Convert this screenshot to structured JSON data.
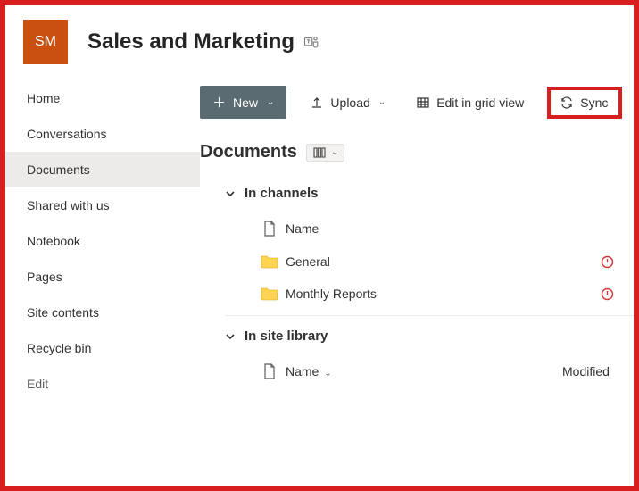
{
  "site": {
    "tile_initials": "SM",
    "title": "Sales and Marketing"
  },
  "sidebar": {
    "items": [
      {
        "label": "Home"
      },
      {
        "label": "Conversations"
      },
      {
        "label": "Documents"
      },
      {
        "label": "Shared with us"
      },
      {
        "label": "Notebook"
      },
      {
        "label": "Pages"
      },
      {
        "label": "Site contents"
      },
      {
        "label": "Recycle bin"
      }
    ],
    "edit_label": "Edit"
  },
  "toolbar": {
    "new_label": "New",
    "upload_label": "Upload",
    "grid_label": "Edit in grid view",
    "sync_label": "Sync"
  },
  "page": {
    "title": "Documents"
  },
  "sections": {
    "channels": {
      "title": "In channels",
      "columns": {
        "name": "Name"
      },
      "rows": [
        {
          "name": "General"
        },
        {
          "name": "Monthly Reports"
        }
      ]
    },
    "library": {
      "title": "In site library",
      "columns": {
        "name": "Name",
        "modified": "Modified"
      }
    }
  }
}
